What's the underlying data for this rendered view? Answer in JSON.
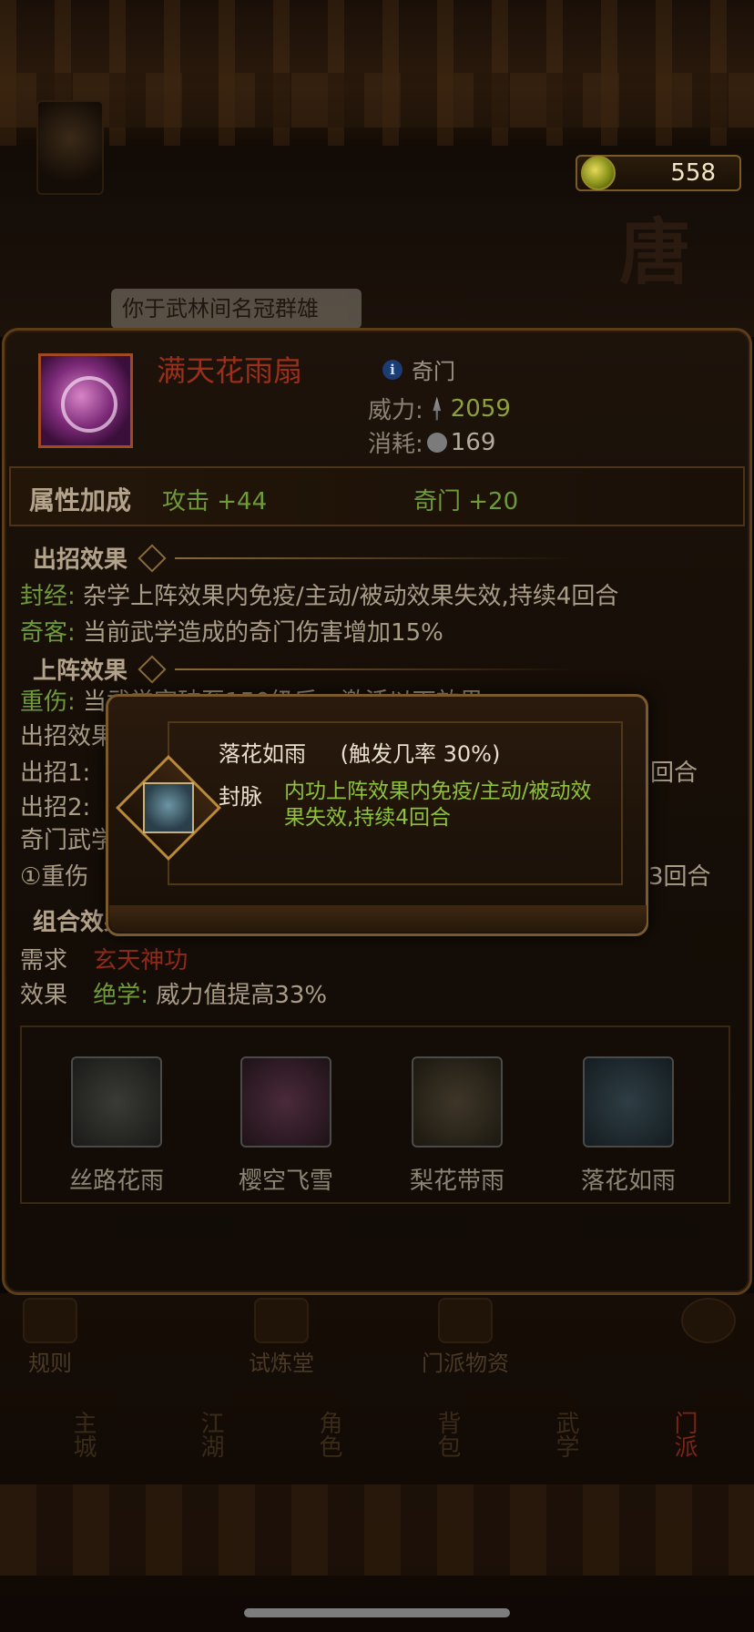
{
  "currency": {
    "value": "558",
    "icon": "coin-cluster-icon"
  },
  "scene": {
    "banner_text": "你于武林间名冠群雄",
    "side_char": "唐"
  },
  "item": {
    "name": "满天花雨扇",
    "type": "奇门",
    "power_label": "威力:",
    "power_value": "2059",
    "cost_label": "消耗:",
    "cost_value": "169"
  },
  "attributes": {
    "title": "属性加成",
    "a": "攻击 +44",
    "b": "奇门 +20"
  },
  "effects": {
    "title": "出招效果",
    "rows": [
      {
        "key": "封经:",
        "text": "杂学上阵效果内免疫/主动/被动效果失效,持续4回合"
      },
      {
        "key": "奇客:",
        "text": "当前武学造成的奇门伤害增加15%"
      }
    ]
  },
  "deploy": {
    "title": "上阵效果",
    "row1_key": "重伤:",
    "row1_text": "当武学突破至150级后，激活以下效果：",
    "row2": "出招效果增加",
    "row3": "出招1:",
    "row3_tail": "回合",
    "row4": "出招2:",
    "row5": "奇门武学",
    "row6": "①重伤",
    "row6_tail": "3回合"
  },
  "combo": {
    "title": "组合效果",
    "req_label": "需求",
    "req_value": "玄天神功",
    "eff_label": "效果",
    "eff_key": "绝学:",
    "eff_text": "威力值提高33%"
  },
  "skills": [
    {
      "name": "丝路花雨"
    },
    {
      "name": "樱空飞雪"
    },
    {
      "name": "梨花带雨"
    },
    {
      "name": "落花如雨"
    }
  ],
  "bottom_functions": [
    {
      "label": "规则"
    },
    {
      "label": "试炼堂"
    },
    {
      "label": "门派物资"
    }
  ],
  "nav": [
    {
      "label": "主城"
    },
    {
      "label": "江湖"
    },
    {
      "label": "角色"
    },
    {
      "label": "背包"
    },
    {
      "label": "武学"
    },
    {
      "label": "门派"
    }
  ],
  "popup": {
    "title": "落花如雨",
    "rate": "(触发几率 30%)",
    "key": "封脉",
    "desc": "内功上阵效果内免疫/主动/被动效果失效,持续4回合"
  }
}
